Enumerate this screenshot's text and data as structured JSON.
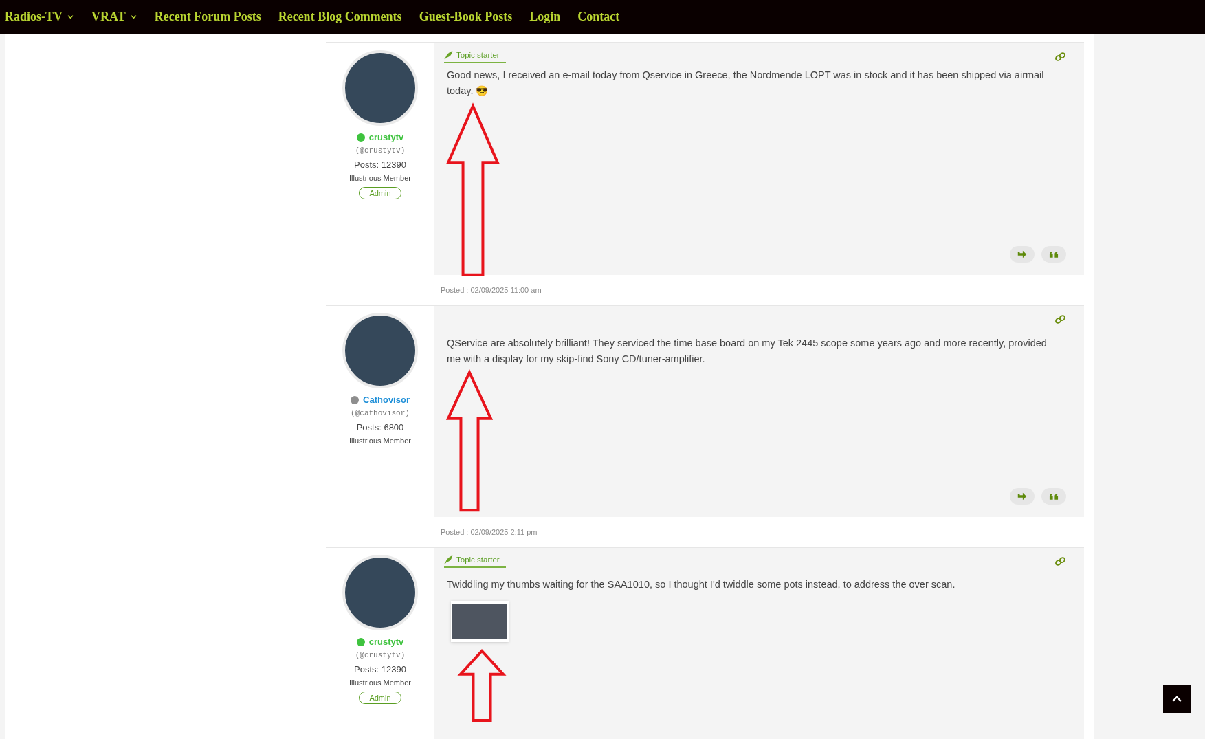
{
  "nav": {
    "items": [
      {
        "label": "Radios-TV",
        "dropdown": true
      },
      {
        "label": "VRAT",
        "dropdown": true
      },
      {
        "label": "Recent Forum Posts",
        "dropdown": false
      },
      {
        "label": "Recent Blog Comments",
        "dropdown": false
      },
      {
        "label": "Guest-Book Posts",
        "dropdown": false
      },
      {
        "label": "Login",
        "dropdown": false
      },
      {
        "label": "Contact",
        "dropdown": false
      }
    ]
  },
  "posts": [
    {
      "author": {
        "name": "crustytv",
        "handle": "(@crustytv)",
        "online": true,
        "posts": "Posts: 12390",
        "rank": "Illustrious Member",
        "badge": "Admin"
      },
      "topic_starter": true,
      "topic_label": "Topic starter",
      "text": "Good news, I received an e-mail today from Qservice in Greece, the Nordmende LOPT was in stock and it has been shipped via airmail today. 😎",
      "posted": "Posted : 02/09/2025 11:00 am"
    },
    {
      "author": {
        "name": "Cathovisor",
        "handle": "(@cathovisor)",
        "online": false,
        "posts": "Posts: 6800",
        "rank": "Illustrious Member"
      },
      "topic_starter": false,
      "text": "QService are absolutely brilliant! They serviced the time base board on my Tek 2445 scope some years ago and more recently, provided me with a display for my skip-find Sony CD/tuner-amplifier.",
      "posted": "Posted : 02/09/2025 2:11 pm"
    },
    {
      "author": {
        "name": "crustytv",
        "handle": "(@crustytv)",
        "online": true,
        "posts": "Posts: 12390",
        "rank": "Illustrious Member",
        "badge": "Admin"
      },
      "topic_starter": true,
      "topic_label": "Topic starter",
      "text": "Twiddling my thumbs waiting for the SAA1010, so I thought I'd twiddle some pots instead, to address the over scan.",
      "attachments": [
        {
          "kind": "photo"
        }
      ]
    }
  ]
}
